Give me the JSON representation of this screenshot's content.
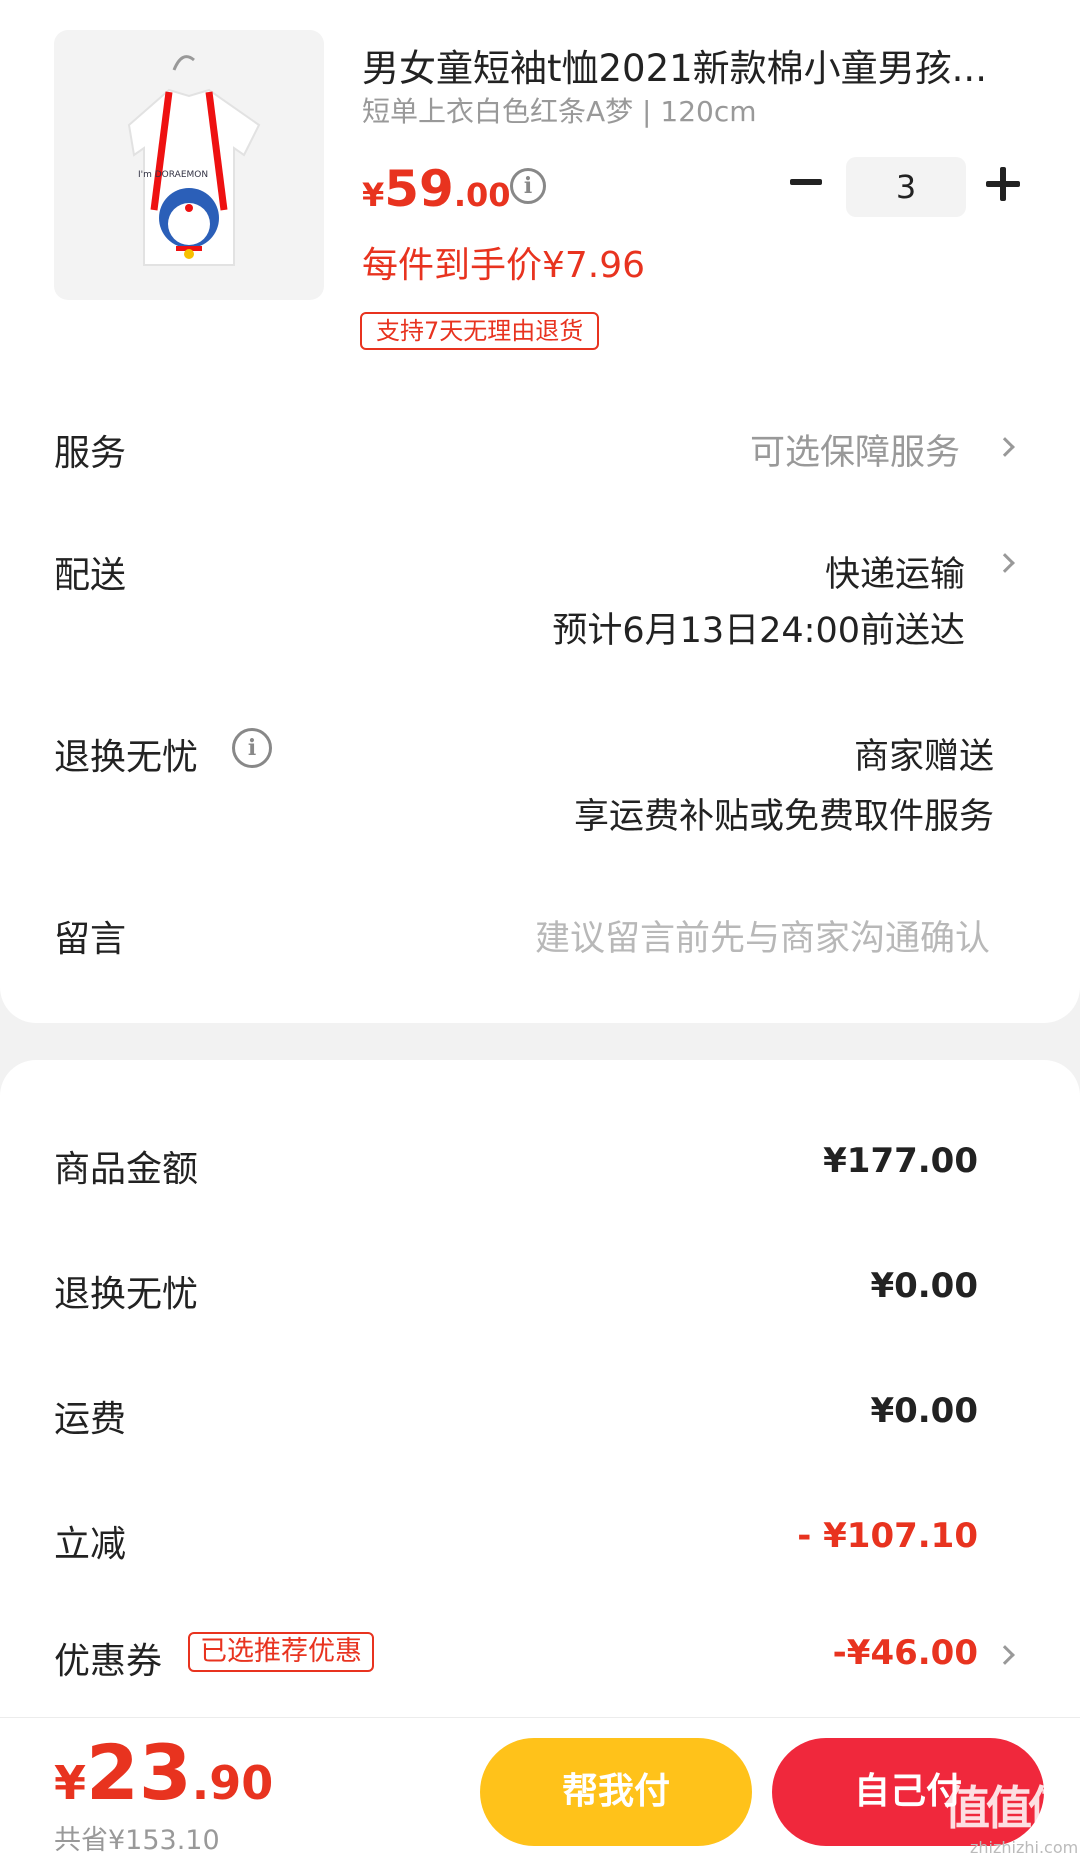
{
  "product": {
    "title": "男女童短袖t恤2021新款棉小童男孩...",
    "spec": "短单上衣白色红条A梦 | 120cm",
    "image_text": "I'm DORAEMON",
    "price_currency": "¥",
    "price_int": "59",
    "price_dec": ".00",
    "quantity": "3",
    "unit_price_label": "每件到手价¥7.96",
    "return_tag": "支持7天无理由退货"
  },
  "rows": {
    "service_label": "服务",
    "service_value": "可选保障服务",
    "delivery_label": "配送",
    "delivery_value": "快递运输",
    "delivery_eta": "预计6月13日24:00前送达",
    "worry_label": "退换无忧",
    "worry_value": "商家赠送",
    "worry_desc": "享运费补贴或免费取件服务",
    "message_label": "留言",
    "message_placeholder": "建议留言前先与商家沟通确认"
  },
  "summary": {
    "goods_label": "商品金额",
    "goods_value": "¥177.00",
    "worry_label": "退换无忧",
    "worry_value": "¥0.00",
    "shipping_label": "运费",
    "shipping_value": "¥0.00",
    "discount_label": "立减",
    "discount_value": "- ¥107.10",
    "coupon_label": "优惠券",
    "coupon_badge": "已选推荐优惠",
    "coupon_value": "-¥46.00"
  },
  "footer": {
    "total_currency": "¥",
    "total_int": "23",
    "total_dec": ".90",
    "saved": "共省¥153.10",
    "help_pay": "帮我付",
    "self_pay": "自己付",
    "watermark": "值值值",
    "watermark_site": "zhizhizhi.com"
  },
  "colors": {
    "accent_red": "#e8331f",
    "help_button": "#ffc21a",
    "self_button": "#f0283c"
  }
}
